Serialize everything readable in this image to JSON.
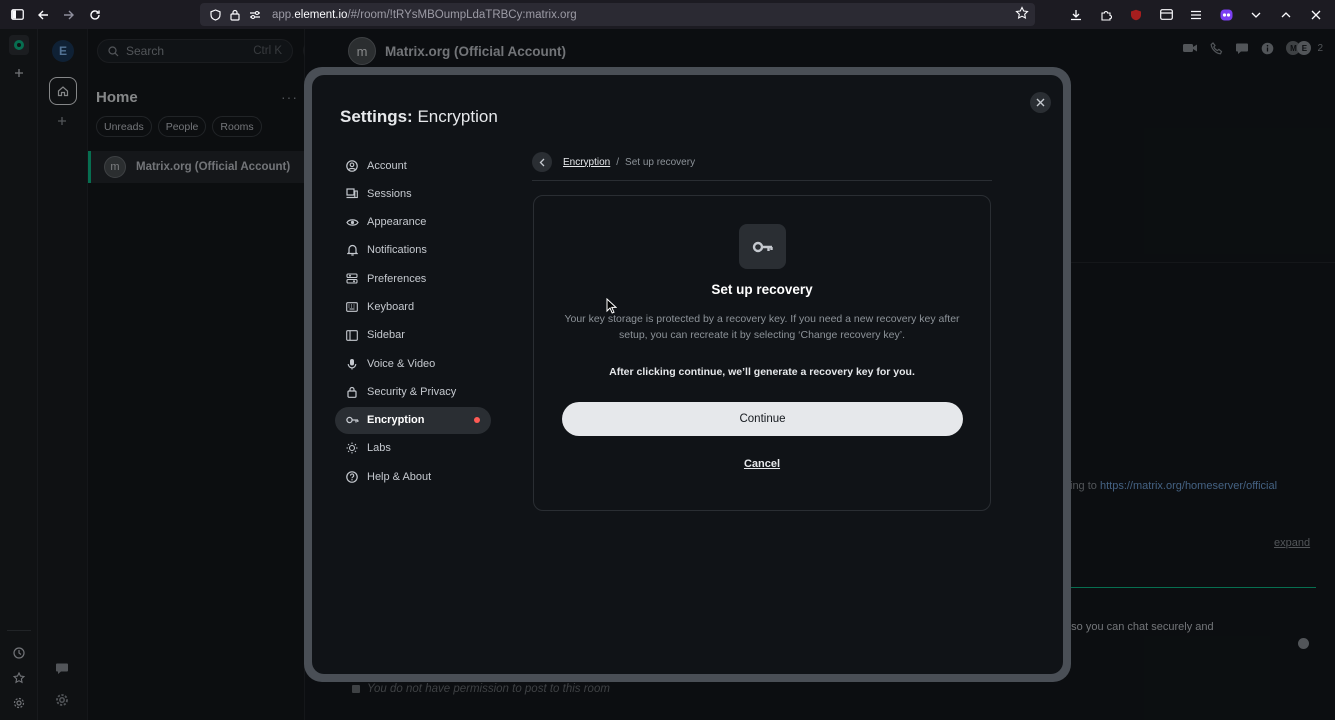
{
  "browser": {
    "url_prefix": "app.",
    "url_domain": "element.io",
    "url_path": "/#/room/!tRYsMBOumpLdaTRBCy:matrix.org"
  },
  "left_panel": {
    "user_initial": "E"
  },
  "room_list": {
    "search_placeholder": "Search",
    "search_shortcut": "Ctrl K",
    "title": "Home",
    "more": "···",
    "filters": [
      "Unreads",
      "People",
      "Rooms"
    ],
    "rooms": [
      {
        "avatar": "m",
        "name": "Matrix.org (Official Account)"
      }
    ]
  },
  "room_header": {
    "avatar": "m",
    "title": "Matrix.org (Official Account)",
    "member_initial_1": "M",
    "member_initial_2": "E",
    "member_count": "2"
  },
  "timeline": {
    "link_prefix": "ing to ",
    "link_url": "https://matrix.org/homeserver/official",
    "expand": "expand",
    "message_fragment": "t, so you can chat securely and",
    "composer_notice": "You do not have permission to post to this room"
  },
  "modal": {
    "title_prefix": "Settings:",
    "title_section": "Encryption",
    "nav": [
      {
        "label": "Account",
        "icon": "user-circle-icon"
      },
      {
        "label": "Sessions",
        "icon": "devices-icon"
      },
      {
        "label": "Appearance",
        "icon": "eye-icon"
      },
      {
        "label": "Notifications",
        "icon": "bell-icon"
      },
      {
        "label": "Preferences",
        "icon": "sliders-icon"
      },
      {
        "label": "Keyboard",
        "icon": "keyboard-icon"
      },
      {
        "label": "Sidebar",
        "icon": "sidebar-icon"
      },
      {
        "label": "Voice & Video",
        "icon": "microphone-icon"
      },
      {
        "label": "Security & Privacy",
        "icon": "lock-icon"
      },
      {
        "label": "Encryption",
        "icon": "key-icon"
      },
      {
        "label": "Labs",
        "icon": "lightbulb-icon"
      },
      {
        "label": "Help & About",
        "icon": "help-icon"
      }
    ],
    "active_nav": "Encryption",
    "breadcrumb": {
      "parent": "Encryption",
      "separator": "/",
      "current": "Set up recovery"
    },
    "card": {
      "title": "Set up recovery",
      "description": "Your key storage is protected by a recovery key. If you need a new recovery key after setup, you can recreate it by selecting ‘Change recovery key’.",
      "note": "After clicking continue, we’ll generate a recovery key for you.",
      "continue_label": "Continue",
      "cancel_label": "Cancel"
    }
  },
  "colors": {
    "accent_green": "#0dbd8b",
    "alert_red": "#ff5b55",
    "background": "#15191e",
    "modal_background": "#101317"
  }
}
